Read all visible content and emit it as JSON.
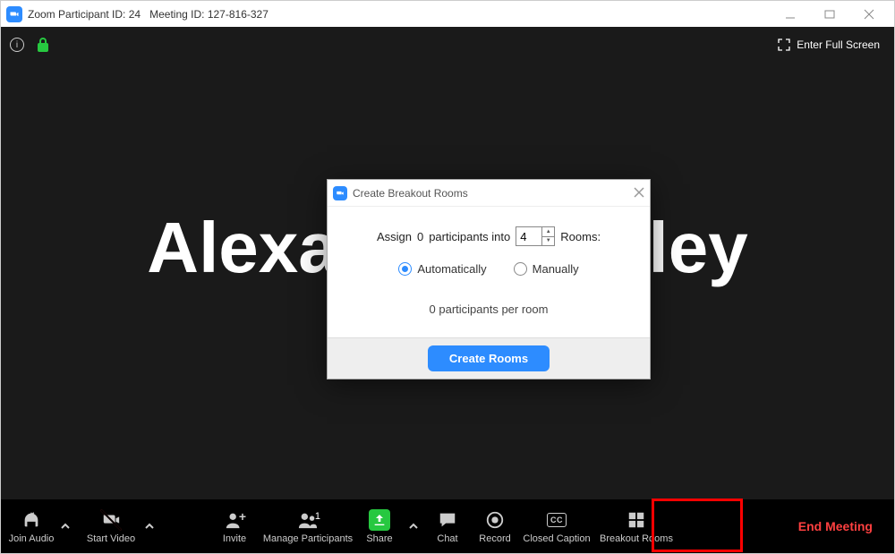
{
  "titlebar": {
    "appName": "Zoom",
    "participantIdLabel": "Participant ID:",
    "participantId": "24",
    "meetingIdLabel": "Meeting ID:",
    "meetingId": "127-816-327"
  },
  "top": {
    "fullscreen": "Enter Full Screen"
  },
  "mainName": "Alexander Hadley",
  "dialog": {
    "title": "Create Breakout Rooms",
    "assignPrefix": "Assign",
    "participantCount": "0",
    "assignMiddle": "participants into",
    "roomsValue": "4",
    "roomsSuffix": "Rooms:",
    "autoLabel": "Automatically",
    "manualLabel": "Manually",
    "perRoom": "0 participants per room",
    "createBtn": "Create Rooms"
  },
  "toolbar": {
    "joinAudio": "Join Audio",
    "startVideo": "Start Video",
    "invite": "Invite",
    "manageParticipants": "Manage Participants",
    "participantCount": "1",
    "share": "Share",
    "chat": "Chat",
    "record": "Record",
    "closedCaption": "Closed Caption",
    "cc": "CC",
    "breakoutRooms": "Breakout Rooms",
    "endMeeting": "End Meeting"
  }
}
